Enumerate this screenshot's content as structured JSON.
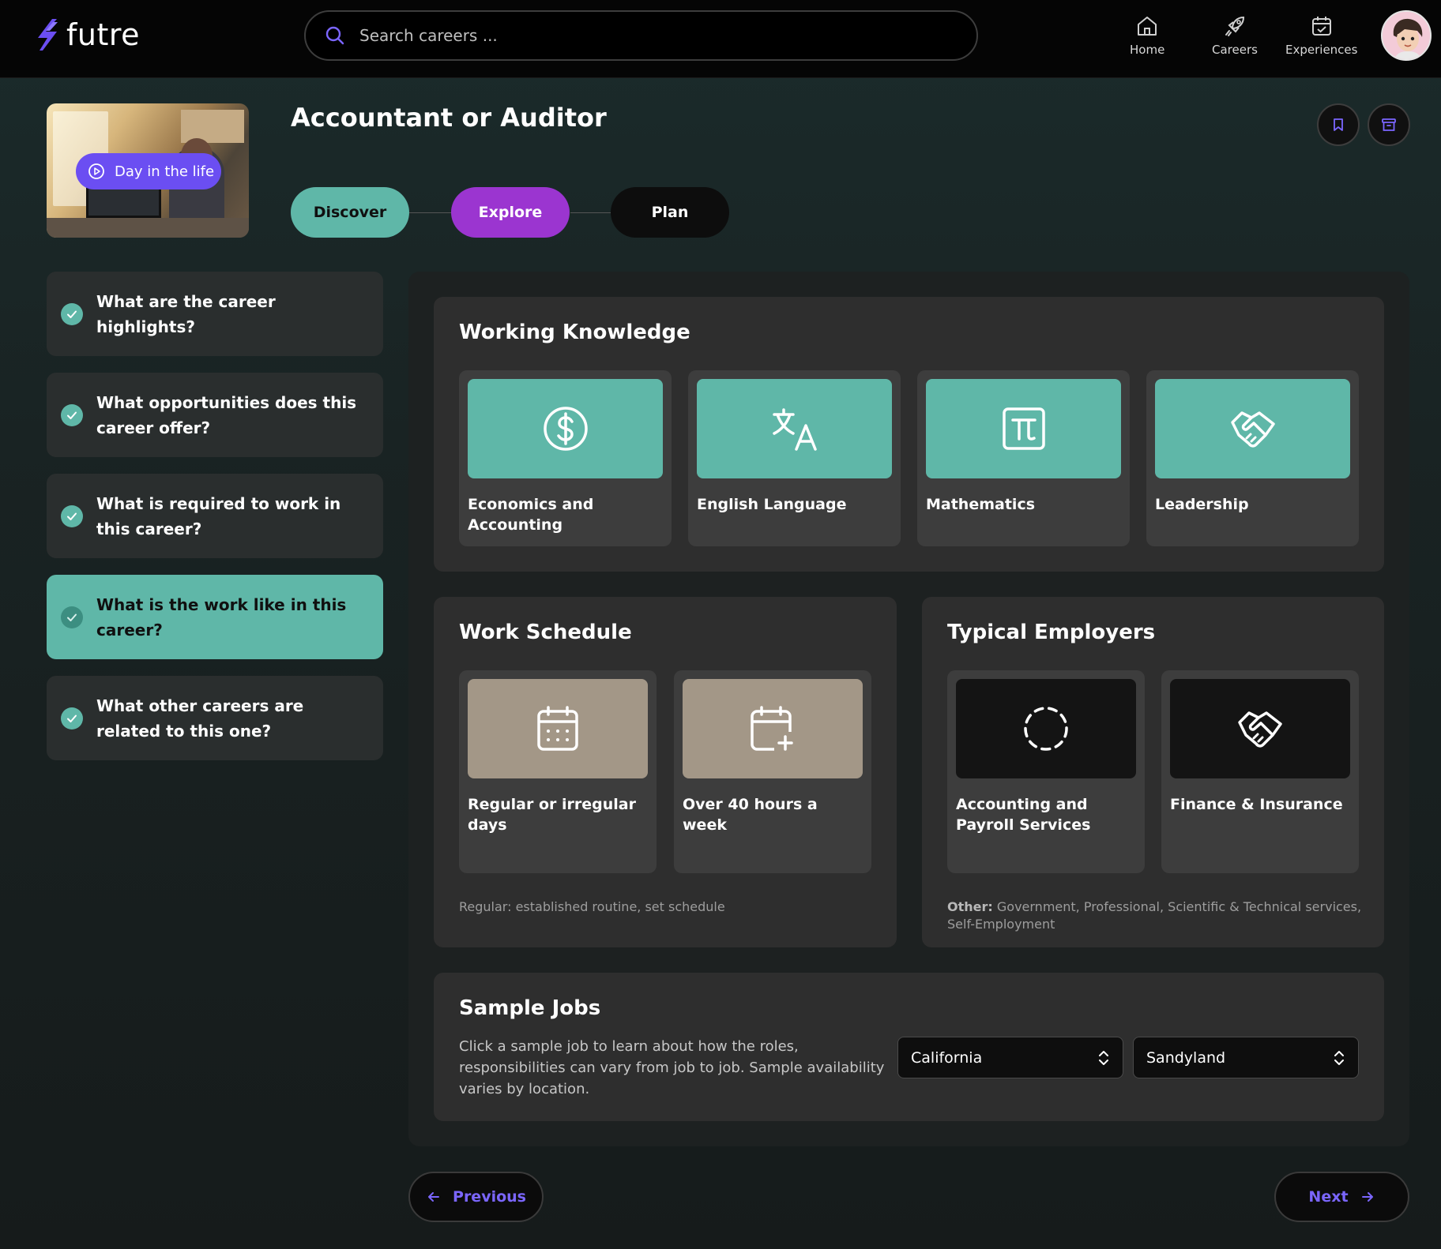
{
  "app": {
    "name": "futre"
  },
  "search": {
    "placeholder": "Search careers ..."
  },
  "nav": {
    "home": "Home",
    "careers": "Careers",
    "experiences": "Experiences"
  },
  "video": {
    "label": "Day in the life"
  },
  "career": {
    "title": "Accountant or Auditor"
  },
  "steps": {
    "discover": "Discover",
    "explore": "Explore",
    "plan": "Plan"
  },
  "questions": [
    {
      "text": "What are the career highlights?",
      "active": false
    },
    {
      "text": "What opportunities does this career offer?",
      "active": false
    },
    {
      "text": "What is required to work in this career?",
      "active": false
    },
    {
      "text": "What is the work like in this career?",
      "active": true
    },
    {
      "text": "What other careers are related to this one?",
      "active": false
    }
  ],
  "working_knowledge": {
    "title": "Working Knowledge",
    "items": [
      {
        "label": "Economics and Accounting",
        "icon": "dollar-circle-icon"
      },
      {
        "label": "English Language",
        "icon": "translate-icon"
      },
      {
        "label": "Mathematics",
        "icon": "pi-icon"
      },
      {
        "label": "Leadership",
        "icon": "handshake-icon"
      }
    ]
  },
  "work_schedule": {
    "title": "Work Schedule",
    "items": [
      {
        "label": "Regular or irregular days",
        "icon": "calendar-icon"
      },
      {
        "label": "Over 40 hours a week",
        "icon": "calendar-plus-icon"
      }
    ],
    "note": "Regular: established routine, set schedule"
  },
  "typical_employers": {
    "title": "Typical Employers",
    "items": [
      {
        "label": "Accounting and Payroll Services",
        "icon": "dashed-circle-icon"
      },
      {
        "label": "Finance & Insurance",
        "icon": "handshake-icon"
      }
    ],
    "note_label": "Other:",
    "note": "Government, Professional, Scientific & Technical services, Self-Employment"
  },
  "sample_jobs": {
    "title": "Sample Jobs",
    "description": "Click a sample job to learn about how the roles, responsibilities can vary from job to job. Sample availability varies by location.",
    "state": "California",
    "city": "Sandyland"
  },
  "footer": {
    "previous": "Previous",
    "next": "Next"
  },
  "colors": {
    "accent": "#6b4ef2",
    "teal": "#5fb7a8",
    "explore": "#9b35d0",
    "link": "#7b66ff"
  }
}
